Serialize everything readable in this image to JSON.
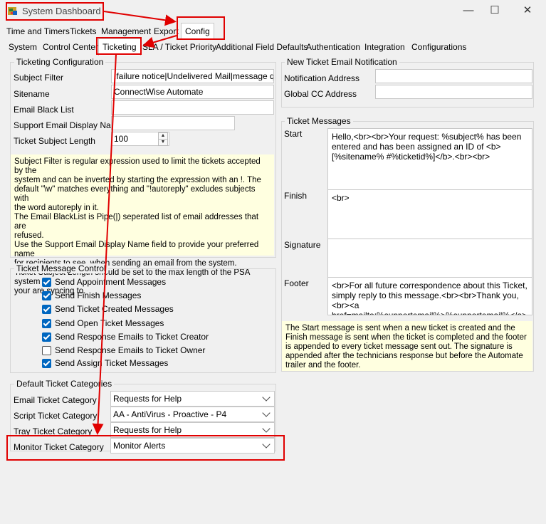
{
  "window": {
    "title": "System Dashboard",
    "controls": [
      "—",
      "☐",
      "✕"
    ]
  },
  "main_tabs": [
    "Time and Timers",
    "Tickets",
    "Management",
    "Export",
    "Config"
  ],
  "sub_tabs": [
    "System",
    "Control Center",
    "Ticketing",
    "SLA / Ticket Priority",
    "Additional Field Defaults",
    "Authentication",
    "Integration",
    "Configurations"
  ],
  "ticketing_config": {
    "title": "Ticketing Configuration",
    "subject_filter_label": "Subject Filter",
    "subject_filter_value": "!failure notice|Undelivered Mail|message quota",
    "sitename_label": "Sitename",
    "sitename_value": "ConnectWise Automate",
    "email_blacklist_label": "Email Black List",
    "email_blacklist_value": "",
    "support_email_label": "Support Email Display Name",
    "support_email_value": "",
    "subject_length_label": "Ticket Subject Length",
    "subject_length_value": "100",
    "help_text": "Subject Filter is regular expression used to limit the tickets accepted by the\nsystem and can be inverted by starting the expression with an !. The\ndefault \"\\w\" matches everything and \"!autoreply\" excludes subjects with\nthe word autoreply in it.\nThe Email BlackList is Pipe(|) seperated list of email addresses that are\nrefused.\nUse the Support Email Display Name field to provide your preferred name\nfor recipients to see, when sending an email from the system.\nTicket Subject Length should be set to the max length of the PSA system\nyour are syncing to."
  },
  "message_control": {
    "title": "Ticket Message Control",
    "items": [
      {
        "label": "Send Appointment Messages",
        "checked": true
      },
      {
        "label": "Send Finish Messages",
        "checked": true
      },
      {
        "label": "Send Ticket Created Messages",
        "checked": true
      },
      {
        "label": "Send Open Ticket Messages",
        "checked": true
      },
      {
        "label": "Send Response Emails to Ticket Creator",
        "checked": true
      },
      {
        "label": "Send Response Emails to Ticket Owner",
        "checked": false
      },
      {
        "label": "Send Assign Ticket Messages",
        "checked": true
      }
    ]
  },
  "categories": {
    "title": "Default Ticket Categories",
    "email_label": "Email Ticket Category",
    "email_value": "Requests for Help",
    "script_label": "Script Ticket Category",
    "script_value": "AA - AntiVirus - Proactive - P4",
    "tray_label": "Tray Ticket Category",
    "tray_value": "Requests for Help",
    "monitor_label": "Monitor Ticket Category",
    "monitor_value": "Monitor Alerts"
  },
  "notification": {
    "title": "New Ticket Email Notification",
    "address_label": "Notification Address",
    "address_value": "",
    "cc_label": "Global CC Address",
    "cc_value": ""
  },
  "messages": {
    "title": "Ticket Messages",
    "start_label": "Start",
    "start_value": "Hello,<br><br>Your request: %subject% has been entered and has been assigned an ID of <b>[%sitename% #%ticketid%]</b>.<br><br>",
    "finish_label": "Finish",
    "finish_value": "<br>",
    "signature_label": "Signature",
    "signature_value": "",
    "footer_label": "Footer",
    "footer_value": "<br>For all future correspondence about this Ticket, simply reply to this message.<br><br>Thank you,<br><a href=mailto:%supportemail%>%supportemail%</a><br>",
    "help_text": "The Start message is sent when a new ticket is created and the Finish message is sent when the ticket is completed and the footer is appended to every ticket message sent out. The signature is appended after the technicians response but before the Automate trailer and the footer."
  },
  "colors": {
    "accent": "#0067c0",
    "highlight": "#e00000",
    "note_bg": "#ffffe0"
  }
}
